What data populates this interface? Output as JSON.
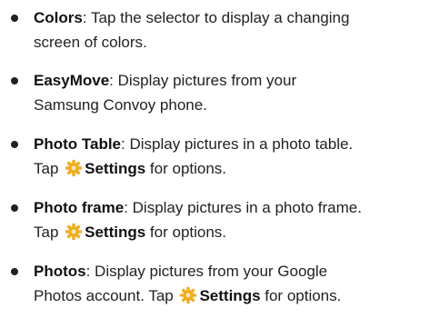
{
  "items": [
    {
      "title": "Colors",
      "line1": ": Tap the selector to display a changing",
      "line2": "screen of colors."
    },
    {
      "title": "EasyMove",
      "line1": ": Display pictures from your",
      "line2": "Samsung Convoy phone."
    },
    {
      "title": "Photo Table",
      "line1": ": Display pictures in a photo table.",
      "line2_pre": "Tap ",
      "settings": "Settings",
      "line2_post": " for options.",
      "icon": "gear-icon"
    },
    {
      "title": "Photo frame",
      "line1": ": Display pictures in a photo frame.",
      "line2_pre": "Tap ",
      "settings": "Settings",
      "line2_post": " for options.",
      "icon": "gear-icon"
    },
    {
      "title": "Photos",
      "line1": ": Display pictures from your Google",
      "line2_pre": "Photos account. Tap ",
      "settings": "Settings",
      "line2_post": " for options.",
      "icon": "gear-icon"
    }
  ],
  "colors": {
    "text": "#222222",
    "gear_icon": "#f0ad1e"
  }
}
